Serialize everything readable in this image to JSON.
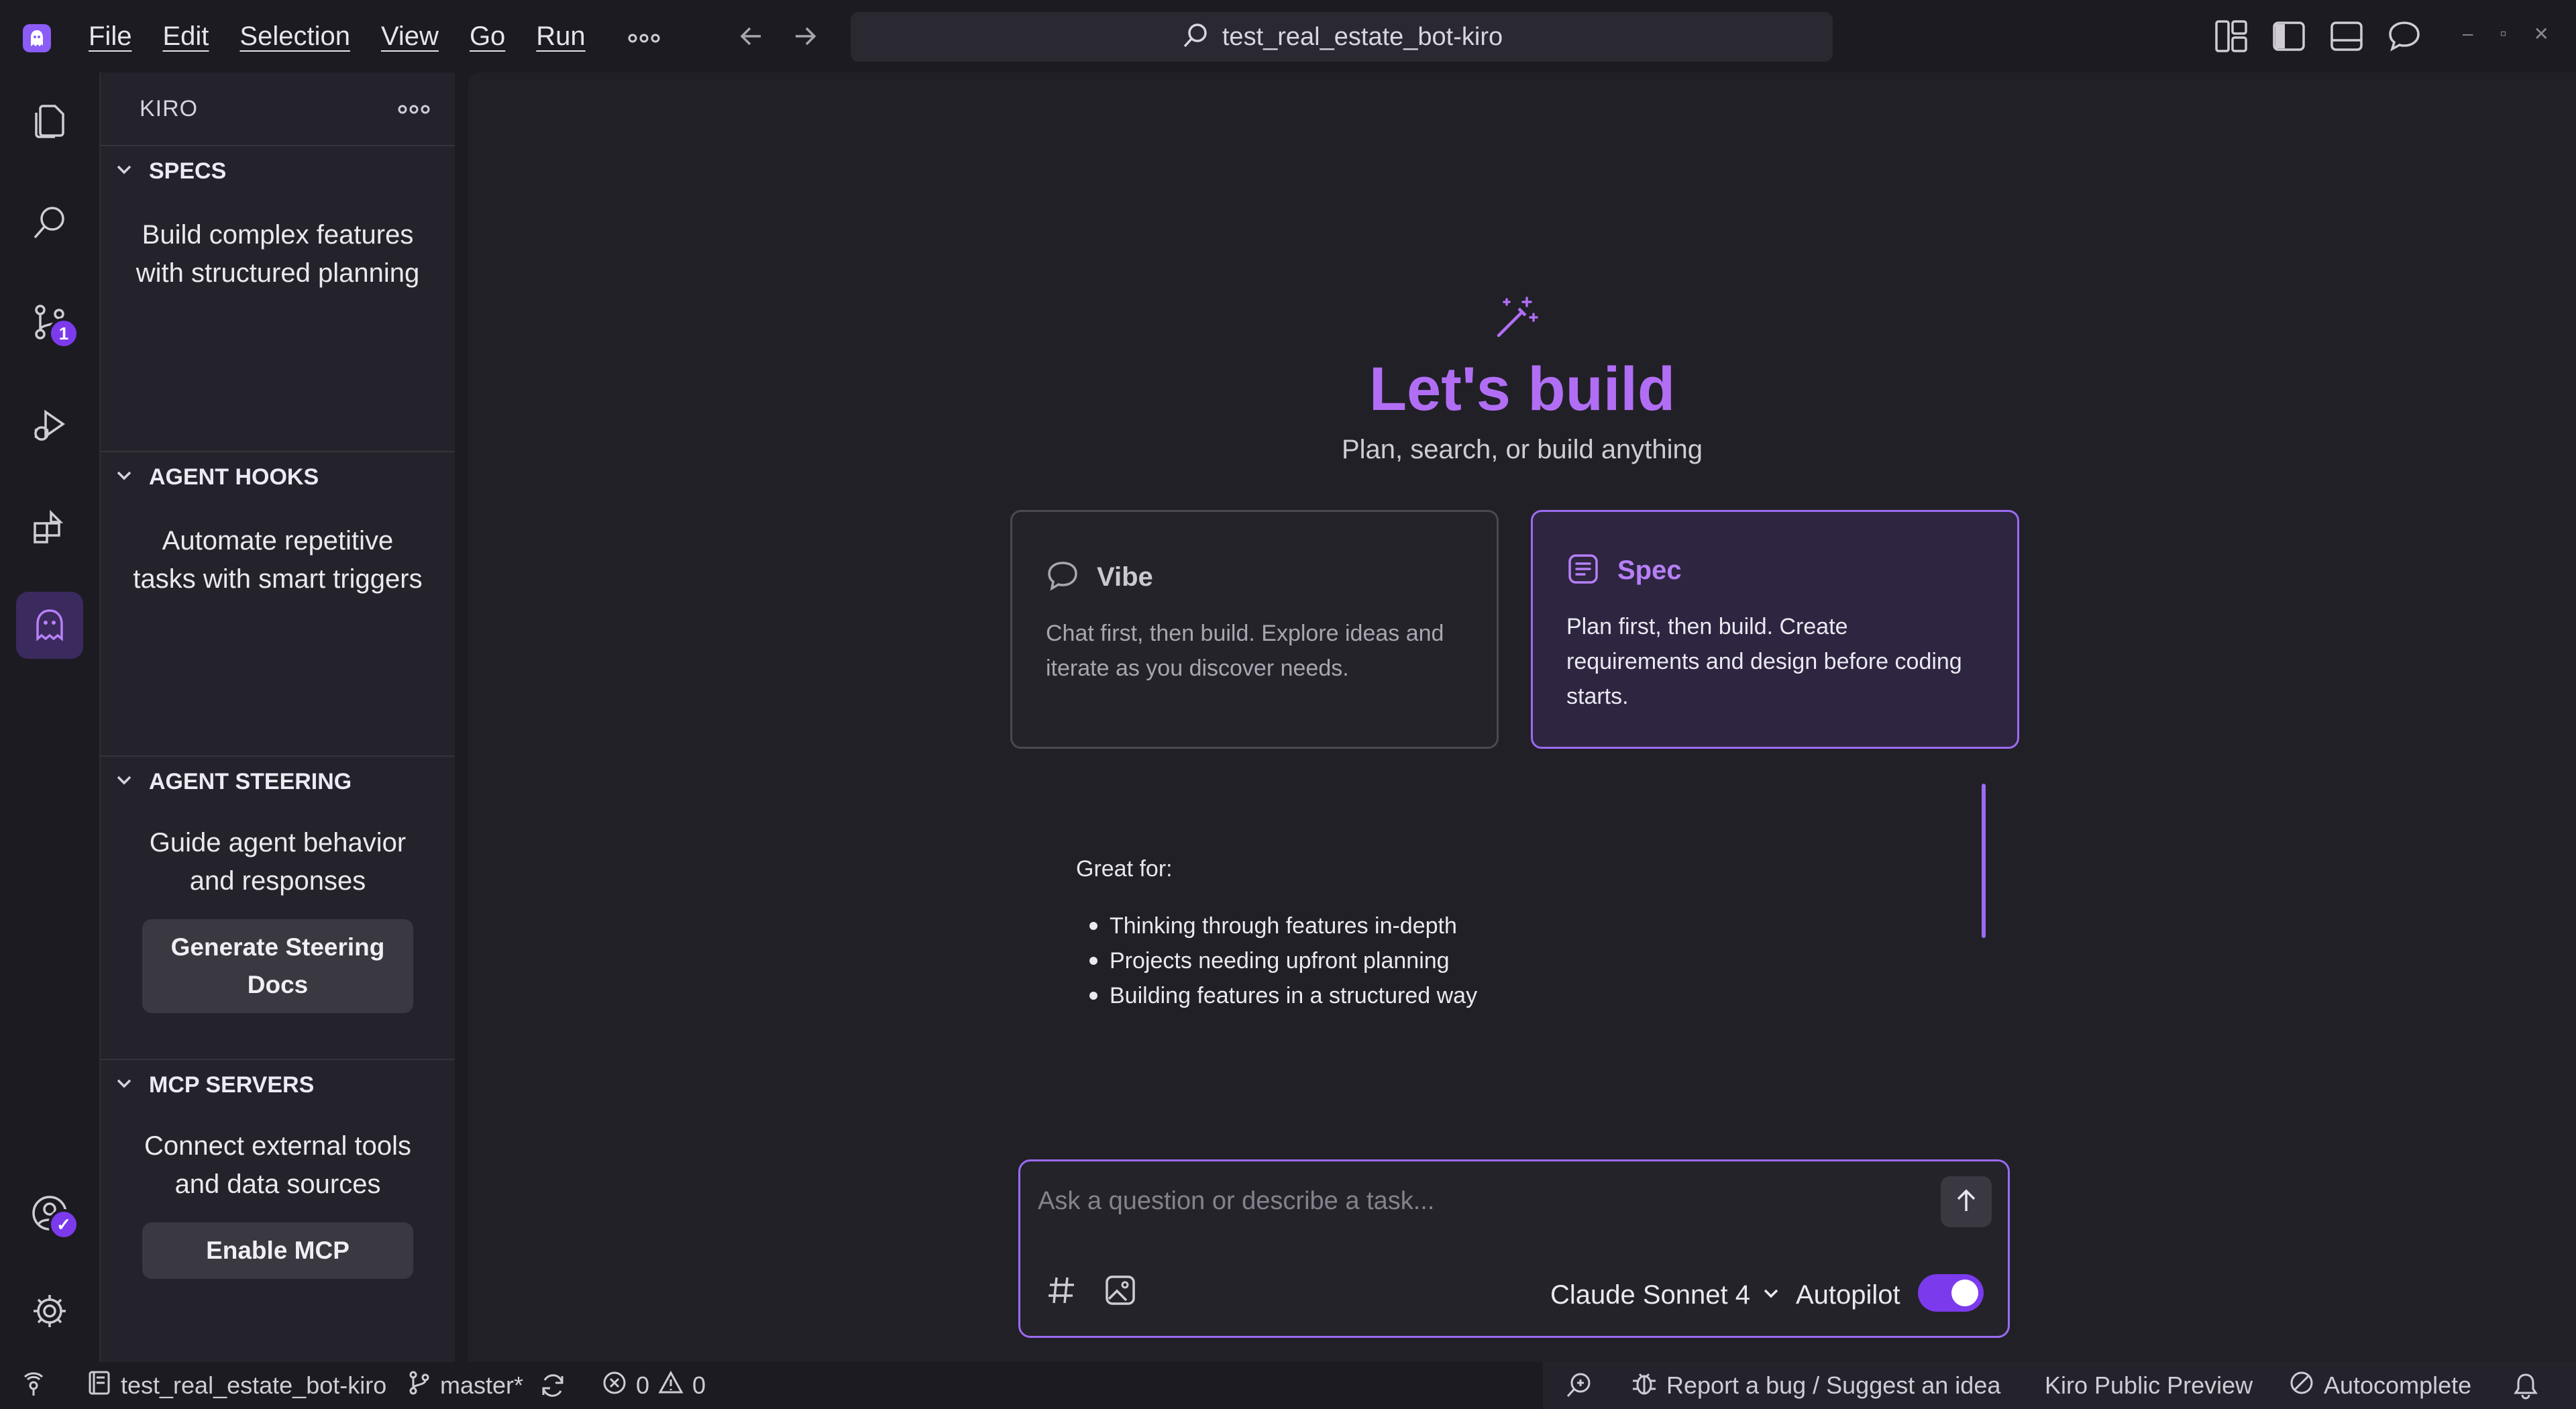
{
  "titlebar": {
    "menu": [
      "File",
      "Edit",
      "Selection",
      "View",
      "Go",
      "Run"
    ],
    "more": "∘∘∘",
    "search_text": "test_real_estate_bot-kiro"
  },
  "activitybar": {
    "source_control_badge": "1"
  },
  "sidebar": {
    "title": "KIRO",
    "more": "∘∘∘",
    "sections": [
      {
        "title": "SPECS",
        "desc": "Build complex features with structured planning"
      },
      {
        "title": "AGENT HOOKS",
        "desc": "Automate repetitive tasks with smart triggers"
      },
      {
        "title": "AGENT STEERING",
        "desc": "Guide agent behavior and responses",
        "button": "Generate Steering Docs"
      },
      {
        "title": "MCP SERVERS",
        "desc": "Connect external tools and data sources",
        "button": "Enable MCP"
      }
    ]
  },
  "main": {
    "title": "Let's build",
    "subtitle": "Plan, search, or build anything",
    "cards": [
      {
        "name": "Vibe",
        "desc": "Chat first, then build. Explore ideas and iterate as you discover needs."
      },
      {
        "name": "Spec",
        "desc": "Plan first, then build. Create requirements and design before coding starts."
      }
    ],
    "great_for_label": "Great for:",
    "great_for": [
      "Thinking through features in-depth",
      "Projects needing upfront planning",
      "Building features in a structured way"
    ],
    "chat": {
      "placeholder": "Ask a question or describe a task...",
      "model": "Claude Sonnet 4",
      "autopilot_label": "Autopilot",
      "autopilot_on": true
    }
  },
  "statusbar": {
    "repo": "test_real_estate_bot-kiro",
    "branch": "master*",
    "errors": "0",
    "warnings": "0",
    "report": "Report a bug / Suggest an idea",
    "preview": "Kiro Public Preview",
    "autocomplete": "Autocomplete"
  },
  "colors": {
    "accent": "#8b5cf6",
    "title_accent": "#b16ef5",
    "background": "#1c1b22"
  }
}
